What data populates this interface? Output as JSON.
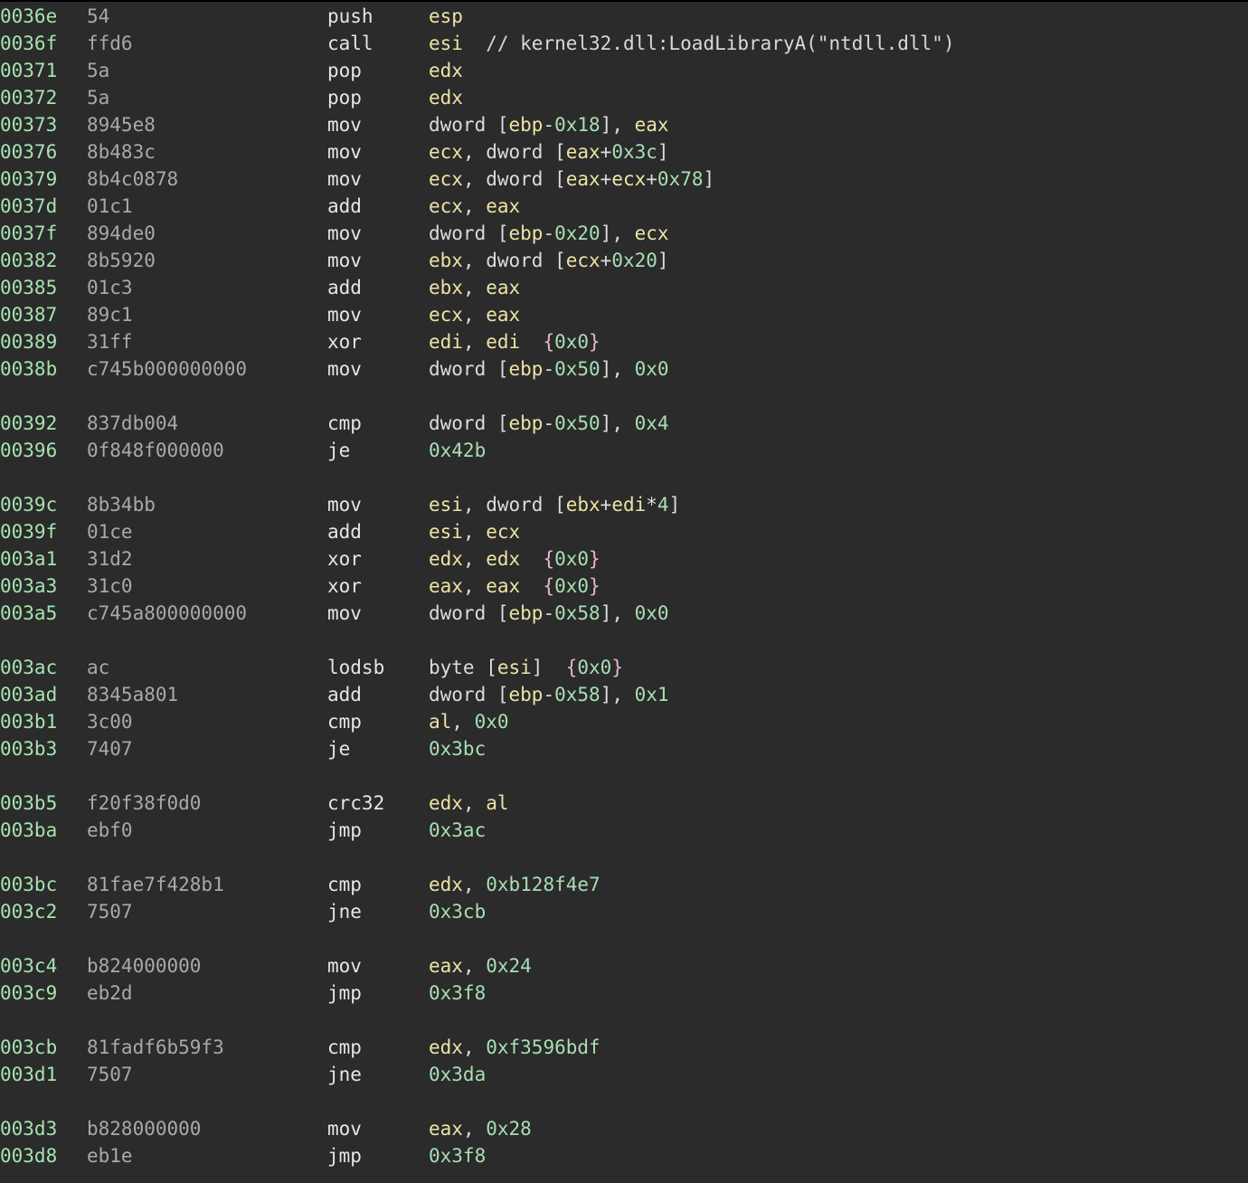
{
  "colors": {
    "background": "#2b2b2b",
    "address": "#a6e3b0",
    "bytes": "#a9a9a9",
    "mnemonic": "#e6e6e6",
    "register": "#ece3a5",
    "number": "#a8dfb3",
    "text": "#dcdcdc",
    "annotation": "#e8b7c8"
  },
  "rows": [
    {
      "addr": "0036e",
      "bytes": "54",
      "mnem": "push",
      "ops": [
        [
          "esp",
          "reg"
        ]
      ]
    },
    {
      "addr": "0036f",
      "bytes": "ffd6",
      "mnem": "call",
      "ops": [
        [
          "esi",
          "reg"
        ],
        [
          "  // kernel32.dll:LoadLibraryA(\"ntdll.dll\")",
          "cmt"
        ]
      ]
    },
    {
      "addr": "00371",
      "bytes": "5a",
      "mnem": "pop",
      "ops": [
        [
          "edx",
          "reg"
        ]
      ]
    },
    {
      "addr": "00372",
      "bytes": "5a",
      "mnem": "pop",
      "ops": [
        [
          "edx",
          "reg"
        ]
      ]
    },
    {
      "addr": "00373",
      "bytes": "8945e8",
      "mnem": "mov",
      "ops": [
        [
          "dword [",
          "txt"
        ],
        [
          "ebp",
          "reg"
        ],
        [
          "-",
          "txt"
        ],
        [
          "0x18",
          "num"
        ],
        [
          "], ",
          "txt"
        ],
        [
          "eax",
          "reg"
        ]
      ]
    },
    {
      "addr": "00376",
      "bytes": "8b483c",
      "mnem": "mov",
      "ops": [
        [
          "ecx",
          "reg"
        ],
        [
          ", dword [",
          "txt"
        ],
        [
          "eax",
          "reg"
        ],
        [
          "+",
          "txt"
        ],
        [
          "0x3c",
          "num"
        ],
        [
          "]",
          "txt"
        ]
      ]
    },
    {
      "addr": "00379",
      "bytes": "8b4c0878",
      "mnem": "mov",
      "ops": [
        [
          "ecx",
          "reg"
        ],
        [
          ", dword [",
          "txt"
        ],
        [
          "eax",
          "reg"
        ],
        [
          "+",
          "txt"
        ],
        [
          "ecx",
          "reg"
        ],
        [
          "+",
          "txt"
        ],
        [
          "0x78",
          "num"
        ],
        [
          "]",
          "txt"
        ]
      ]
    },
    {
      "addr": "0037d",
      "bytes": "01c1",
      "mnem": "add",
      "ops": [
        [
          "ecx",
          "reg"
        ],
        [
          ", ",
          "txt"
        ],
        [
          "eax",
          "reg"
        ]
      ]
    },
    {
      "addr": "0037f",
      "bytes": "894de0",
      "mnem": "mov",
      "ops": [
        [
          "dword [",
          "txt"
        ],
        [
          "ebp",
          "reg"
        ],
        [
          "-",
          "txt"
        ],
        [
          "0x20",
          "num"
        ],
        [
          "], ",
          "txt"
        ],
        [
          "ecx",
          "reg"
        ]
      ]
    },
    {
      "addr": "00382",
      "bytes": "8b5920",
      "mnem": "mov",
      "ops": [
        [
          "ebx",
          "reg"
        ],
        [
          ", dword [",
          "txt"
        ],
        [
          "ecx",
          "reg"
        ],
        [
          "+",
          "txt"
        ],
        [
          "0x20",
          "num"
        ],
        [
          "]",
          "txt"
        ]
      ]
    },
    {
      "addr": "00385",
      "bytes": "01c3",
      "mnem": "add",
      "ops": [
        [
          "ebx",
          "reg"
        ],
        [
          ", ",
          "txt"
        ],
        [
          "eax",
          "reg"
        ]
      ]
    },
    {
      "addr": "00387",
      "bytes": "89c1",
      "mnem": "mov",
      "ops": [
        [
          "ecx",
          "reg"
        ],
        [
          ", ",
          "txt"
        ],
        [
          "eax",
          "reg"
        ]
      ]
    },
    {
      "addr": "00389",
      "bytes": "31ff",
      "mnem": "xor",
      "ops": [
        [
          "edi",
          "reg"
        ],
        [
          ", ",
          "txt"
        ],
        [
          "edi",
          "reg"
        ],
        [
          "  {",
          "brace"
        ],
        [
          "0x0",
          "num"
        ],
        [
          "}",
          "brace"
        ]
      ]
    },
    {
      "addr": "0038b",
      "bytes": "c745b000000000",
      "mnem": "mov",
      "ops": [
        [
          "dword [",
          "txt"
        ],
        [
          "ebp",
          "reg"
        ],
        [
          "-",
          "txt"
        ],
        [
          "0x50",
          "num"
        ],
        [
          "], ",
          "txt"
        ],
        [
          "0x0",
          "num"
        ]
      ]
    },
    {
      "gap": true
    },
    {
      "addr": "00392",
      "bytes": "837db004",
      "mnem": "cmp",
      "ops": [
        [
          "dword [",
          "txt"
        ],
        [
          "ebp",
          "reg"
        ],
        [
          "-",
          "txt"
        ],
        [
          "0x50",
          "num"
        ],
        [
          "], ",
          "txt"
        ],
        [
          "0x4",
          "num"
        ]
      ]
    },
    {
      "addr": "00396",
      "bytes": "0f848f000000",
      "mnem": "je",
      "ops": [
        [
          "0x42b",
          "num"
        ]
      ]
    },
    {
      "gap": true
    },
    {
      "addr": "0039c",
      "bytes": "8b34bb",
      "mnem": "mov",
      "ops": [
        [
          "esi",
          "reg"
        ],
        [
          ", dword [",
          "txt"
        ],
        [
          "ebx",
          "reg"
        ],
        [
          "+",
          "txt"
        ],
        [
          "edi",
          "reg"
        ],
        [
          "*",
          "txt"
        ],
        [
          "4",
          "num"
        ],
        [
          "]",
          "txt"
        ]
      ]
    },
    {
      "addr": "0039f",
      "bytes": "01ce",
      "mnem": "add",
      "ops": [
        [
          "esi",
          "reg"
        ],
        [
          ", ",
          "txt"
        ],
        [
          "ecx",
          "reg"
        ]
      ]
    },
    {
      "addr": "003a1",
      "bytes": "31d2",
      "mnem": "xor",
      "ops": [
        [
          "edx",
          "reg"
        ],
        [
          ", ",
          "txt"
        ],
        [
          "edx",
          "reg"
        ],
        [
          "  {",
          "brace"
        ],
        [
          "0x0",
          "num"
        ],
        [
          "}",
          "brace"
        ]
      ]
    },
    {
      "addr": "003a3",
      "bytes": "31c0",
      "mnem": "xor",
      "ops": [
        [
          "eax",
          "reg"
        ],
        [
          ", ",
          "txt"
        ],
        [
          "eax",
          "reg"
        ],
        [
          "  {",
          "brace"
        ],
        [
          "0x0",
          "num"
        ],
        [
          "}",
          "brace"
        ]
      ]
    },
    {
      "addr": "003a5",
      "bytes": "c745a800000000",
      "mnem": "mov",
      "ops": [
        [
          "dword [",
          "txt"
        ],
        [
          "ebp",
          "reg"
        ],
        [
          "-",
          "txt"
        ],
        [
          "0x58",
          "num"
        ],
        [
          "], ",
          "txt"
        ],
        [
          "0x0",
          "num"
        ]
      ]
    },
    {
      "gap": true
    },
    {
      "addr": "003ac",
      "bytes": "ac",
      "mnem": "lodsb",
      "ops": [
        [
          "byte [",
          "txt"
        ],
        [
          "esi",
          "reg"
        ],
        [
          "]",
          "txt"
        ],
        [
          "  {",
          "brace"
        ],
        [
          "0x0",
          "num"
        ],
        [
          "}",
          "brace"
        ]
      ]
    },
    {
      "addr": "003ad",
      "bytes": "8345a801",
      "mnem": "add",
      "ops": [
        [
          "dword [",
          "txt"
        ],
        [
          "ebp",
          "reg"
        ],
        [
          "-",
          "txt"
        ],
        [
          "0x58",
          "num"
        ],
        [
          "], ",
          "txt"
        ],
        [
          "0x1",
          "num"
        ]
      ]
    },
    {
      "addr": "003b1",
      "bytes": "3c00",
      "mnem": "cmp",
      "ops": [
        [
          "al",
          "reg"
        ],
        [
          ", ",
          "txt"
        ],
        [
          "0x0",
          "num"
        ]
      ]
    },
    {
      "addr": "003b3",
      "bytes": "7407",
      "mnem": "je",
      "ops": [
        [
          "0x3bc",
          "num"
        ]
      ]
    },
    {
      "gap": true
    },
    {
      "addr": "003b5",
      "bytes": "f20f38f0d0",
      "mnem": "crc32",
      "ops": [
        [
          "edx",
          "reg"
        ],
        [
          ", ",
          "txt"
        ],
        [
          "al",
          "reg"
        ]
      ]
    },
    {
      "addr": "003ba",
      "bytes": "ebf0",
      "mnem": "jmp",
      "ops": [
        [
          "0x3ac",
          "num"
        ]
      ]
    },
    {
      "gap": true
    },
    {
      "addr": "003bc",
      "bytes": "81fae7f428b1",
      "mnem": "cmp",
      "ops": [
        [
          "edx",
          "reg"
        ],
        [
          ", ",
          "txt"
        ],
        [
          "0xb128f4e7",
          "num"
        ]
      ]
    },
    {
      "addr": "003c2",
      "bytes": "7507",
      "mnem": "jne",
      "ops": [
        [
          "0x3cb",
          "num"
        ]
      ]
    },
    {
      "gap": true
    },
    {
      "addr": "003c4",
      "bytes": "b824000000",
      "mnem": "mov",
      "ops": [
        [
          "eax",
          "reg"
        ],
        [
          ", ",
          "txt"
        ],
        [
          "0x24",
          "num"
        ]
      ]
    },
    {
      "addr": "003c9",
      "bytes": "eb2d",
      "mnem": "jmp",
      "ops": [
        [
          "0x3f8",
          "num"
        ]
      ]
    },
    {
      "gap": true
    },
    {
      "addr": "003cb",
      "bytes": "81fadf6b59f3",
      "mnem": "cmp",
      "ops": [
        [
          "edx",
          "reg"
        ],
        [
          ", ",
          "txt"
        ],
        [
          "0xf3596bdf",
          "num"
        ]
      ]
    },
    {
      "addr": "003d1",
      "bytes": "7507",
      "mnem": "jne",
      "ops": [
        [
          "0x3da",
          "num"
        ]
      ]
    },
    {
      "gap": true
    },
    {
      "addr": "003d3",
      "bytes": "b828000000",
      "mnem": "mov",
      "ops": [
        [
          "eax",
          "reg"
        ],
        [
          ", ",
          "txt"
        ],
        [
          "0x28",
          "num"
        ]
      ]
    },
    {
      "addr": "003d8",
      "bytes": "eb1e",
      "mnem": "jmp",
      "ops": [
        [
          "0x3f8",
          "num"
        ]
      ]
    }
  ]
}
